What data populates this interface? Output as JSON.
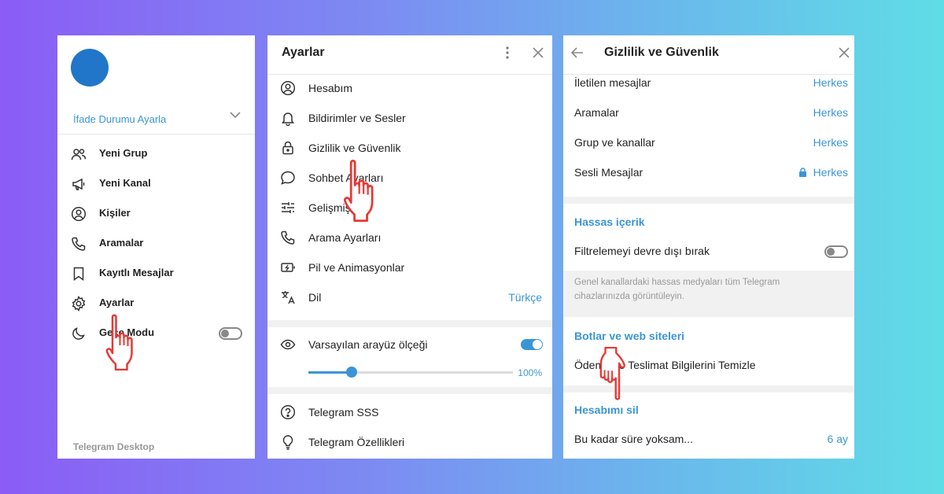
{
  "panel_menu": {
    "status_link": "İfade Durumu Ayarla",
    "items": [
      {
        "icon": "group-icon",
        "label": "Yeni Grup"
      },
      {
        "icon": "megaphone-icon",
        "label": "Yeni Kanal"
      },
      {
        "icon": "contact-icon",
        "label": "Kişiler"
      },
      {
        "icon": "phone-icon",
        "label": "Aramalar"
      },
      {
        "icon": "bookmark-icon",
        "label": "Kayıtlı Mesajlar"
      },
      {
        "icon": "gear-icon",
        "label": "Ayarlar"
      },
      {
        "icon": "moon-icon",
        "label": "Gece Modu"
      }
    ],
    "night_mode_on": false,
    "footer": "Telegram Desktop"
  },
  "panel_settings": {
    "title": "Ayarlar",
    "items": [
      {
        "icon": "account-icon",
        "label": "Hesabım"
      },
      {
        "icon": "bell-icon",
        "label": "Bildirimler ve Sesler"
      },
      {
        "icon": "lock-icon",
        "label": "Gizlilik ve Güvenlik"
      },
      {
        "icon": "chat-bubble-icon",
        "label": "Sohbet Ayarları"
      },
      {
        "icon": "sliders-icon",
        "label": "Gelişmiş"
      },
      {
        "icon": "phone-icon",
        "label": "Arama Ayarları"
      },
      {
        "icon": "battery-icon",
        "label": "Pil ve Animasyonlar"
      },
      {
        "icon": "translate-icon",
        "label": "Dil",
        "value": "Türkçe"
      }
    ],
    "scale": {
      "icon": "eye-icon",
      "label": "Varsayılan arayüz ölçeği",
      "toggle_on": true,
      "value_label": "100%",
      "slider_fraction": 0.21
    },
    "help_items": [
      {
        "icon": "question-icon",
        "label": "Telegram SSS"
      },
      {
        "icon": "lightbulb-icon",
        "label": "Telegram Özellikleri"
      }
    ]
  },
  "panel_privacy": {
    "title": "Gizlilik ve Güvenlik",
    "rows": [
      {
        "label": "İletilen mesajlar",
        "value": "Herkes"
      },
      {
        "label": "Aramalar",
        "value": "Herkes"
      },
      {
        "label": "Grup ve kanallar",
        "value": "Herkes"
      },
      {
        "label": "Sesli Mesajlar",
        "value": "Herkes",
        "locked": true
      }
    ],
    "sensitive": {
      "heading": "Hassas içerik",
      "toggle_label": "Filtrelemeyi devre dışı bırak",
      "toggle_on": false,
      "note": "Genel kanallardaki hassas medyaları tüm Telegram cihazlarınızda görüntüleyin."
    },
    "bots": {
      "heading": "Botlar ve web siteleri",
      "row_label": "Ödeme ve Teslimat Bilgilerini Temizle"
    },
    "delete": {
      "heading": "Hesabımı sil",
      "row_label": "Bu kadar süre yoksam...",
      "row_value": "6 ay"
    }
  },
  "colors": {
    "accent": "#3a95d6",
    "avatar": "#2176c9",
    "pointer": "#e53935"
  }
}
